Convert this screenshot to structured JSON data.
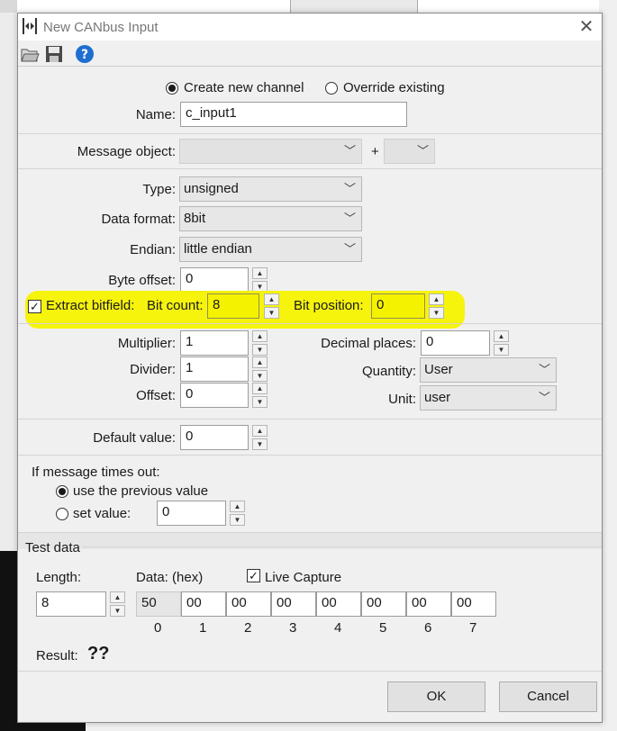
{
  "window": {
    "title": "New CANbus Input",
    "close": "✕"
  },
  "channel_mode": {
    "create_label": "Create new channel",
    "override_label": "Override existing",
    "selected": "create"
  },
  "name": {
    "label": "Name:",
    "value": "c_input1"
  },
  "message": {
    "label": "Message object:",
    "value": "",
    "plus": "+",
    "extra_value": ""
  },
  "type": {
    "label": "Type:",
    "value": "unsigned"
  },
  "data_format": {
    "label": "Data format:",
    "value": "8bit"
  },
  "endian": {
    "label": "Endian:",
    "value": "little endian"
  },
  "byte_offset": {
    "label": "Byte offset:",
    "value": "0"
  },
  "bitfield": {
    "label": "Extract bitfield:",
    "checked": true,
    "bit_count_label": "Bit count:",
    "bit_count": "8",
    "bit_position_label": "Bit position:",
    "bit_position": "0"
  },
  "multiplier": {
    "label": "Multiplier:",
    "value": "1"
  },
  "divider": {
    "label": "Divider:",
    "value": "1"
  },
  "offset": {
    "label": "Offset:",
    "value": "0"
  },
  "decimal_places": {
    "label": "Decimal places:",
    "value": "0"
  },
  "quantity": {
    "label": "Quantity:",
    "value": "User"
  },
  "unit": {
    "label": "Unit:",
    "value": "user"
  },
  "default_value": {
    "label": "Default value:",
    "value": "0"
  },
  "timeout": {
    "heading": "If message times out:",
    "previous_label": "use the previous value",
    "set_label": "set value:",
    "set_value": "0",
    "selected": "previous"
  },
  "test_data": {
    "heading": "Test data",
    "length_label": "Length:",
    "length": "8",
    "data_label": "Data: (hex)",
    "live_capture_label": "Live Capture",
    "live_capture": true,
    "bytes": [
      "50",
      "00",
      "00",
      "00",
      "00",
      "00",
      "00",
      "00"
    ],
    "indices": [
      "0",
      "1",
      "2",
      "3",
      "4",
      "5",
      "6",
      "7"
    ],
    "result_label": "Result:",
    "result": "??"
  },
  "buttons": {
    "ok": "OK",
    "cancel": "Cancel"
  },
  "colors": {
    "highlight": "#f5f200",
    "help_icon": "#1e6fd0"
  },
  "icons": [
    "dialog-app-icon",
    "open-folder-icon",
    "save-disk-icon",
    "help-icon",
    "close-icon",
    "chevron-down-icon"
  ]
}
